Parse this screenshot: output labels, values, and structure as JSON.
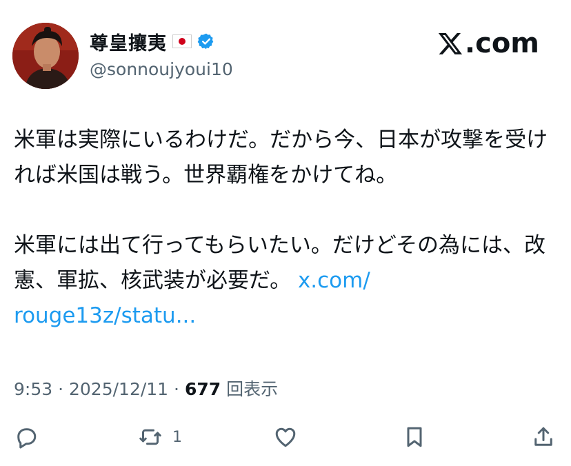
{
  "post": {
    "author_name": "尊皇攘夷",
    "author_handle": "@sonnoujyoui10",
    "paragraph1": "米軍は実際にいるわけだ。だから今、日本が攻撃を受ければ米国は戦う。世界覇権をかけてね。",
    "paragraph2_text": "米軍には出て行ってもらいたい。だけどその為には、改憲、軍拡、核武装が必要だ。",
    "link_line1": "x.com/",
    "link_line2": "rouge13z/statu...",
    "time": "9:53",
    "date": "2025/12/11",
    "views_count": "677",
    "views_label": "回表示"
  },
  "site_label": ".com",
  "actions": {
    "reply": {
      "icon": "reply-icon"
    },
    "repost": {
      "icon": "repost-icon",
      "count": "1"
    },
    "like": {
      "icon": "heart-icon"
    },
    "bookmark": {
      "icon": "bookmark-icon"
    },
    "share": {
      "icon": "share-icon"
    }
  },
  "colors": {
    "link": "#1d9bf0",
    "verified": "#1d9bf0",
    "secondary_text": "#536471",
    "flag_red": "#d0021b"
  }
}
